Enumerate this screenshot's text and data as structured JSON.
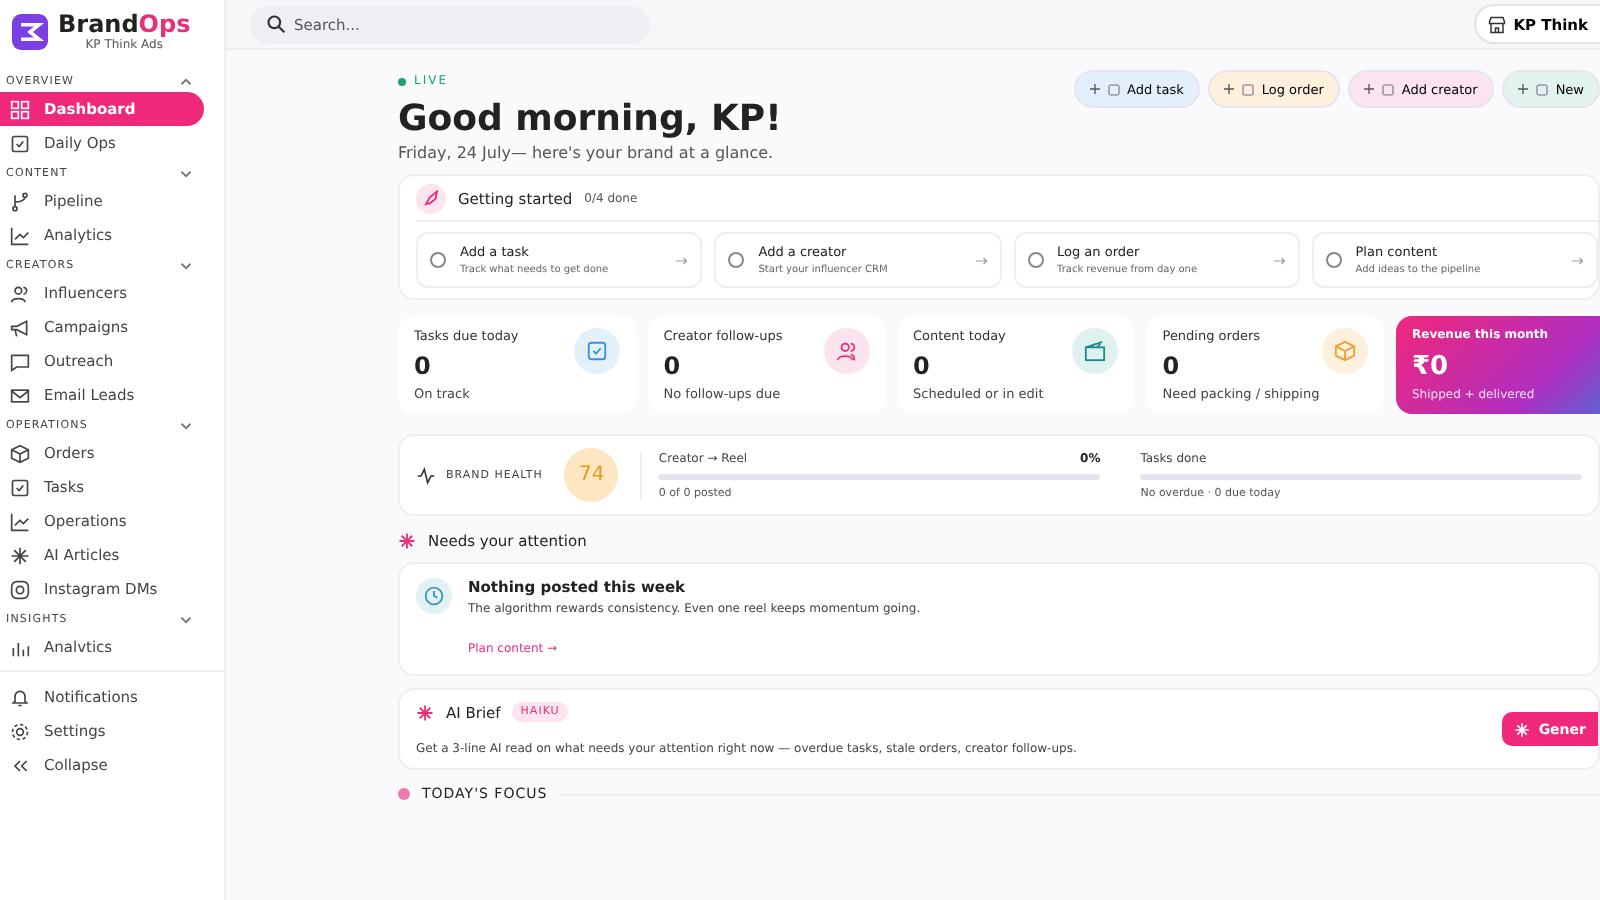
{
  "brand": {
    "name_a": "Brand",
    "name_b": "Ops",
    "workspace": "KP Think Ads"
  },
  "sidebar": {
    "sections": [
      {
        "title": "OVERVIEW",
        "expanded": true,
        "items": [
          {
            "label": "Dashboard",
            "selected": true
          },
          {
            "label": "Daily Ops",
            "selected": false
          }
        ]
      },
      {
        "title": "CONTENT",
        "expanded": false,
        "items": [
          {
            "label": "Pipeline",
            "selected": false
          },
          {
            "label": "Analytics",
            "selected": false
          }
        ]
      },
      {
        "title": "CREATORS",
        "expanded": false,
        "items": [
          {
            "label": "Influencers",
            "selected": false
          },
          {
            "label": "Campaigns",
            "selected": false
          },
          {
            "label": "Outreach",
            "selected": false
          },
          {
            "label": "Email Leads",
            "selected": false
          }
        ]
      },
      {
        "title": "OPERATIONS",
        "expanded": false,
        "items": [
          {
            "label": "Orders",
            "selected": false
          },
          {
            "label": "Tasks",
            "selected": false
          },
          {
            "label": "Operations",
            "selected": false
          },
          {
            "label": "AI Articles",
            "selected": false
          },
          {
            "label": "Instagram DMs",
            "selected": false
          }
        ]
      },
      {
        "title": "INSIGHTS",
        "expanded": false,
        "items": [
          {
            "label": "Analvtics",
            "selected": false
          }
        ]
      }
    ],
    "footer": [
      {
        "label": "Notifications"
      },
      {
        "label": "Settings"
      },
      {
        "label": "Collapse"
      }
    ]
  },
  "search": {
    "placeholder": "Search..."
  },
  "workspace_button": "KP Think",
  "live": "LIVE",
  "greeting": "Good morning, KP!",
  "subtitle": "Friday, 24 July— here's your brand at a glance.",
  "quick_actions": [
    {
      "label": "Add task",
      "color": "#e3f0fb"
    },
    {
      "label": "Log order",
      "color": "#fdf1dd"
    },
    {
      "label": "Add creator",
      "color": "#fbe3ef"
    },
    {
      "label": "New",
      "color": "#e2f3ef"
    }
  ],
  "getting_started": {
    "title": "Getting started",
    "count": "0/4 done",
    "steps": [
      {
        "title": "Add a task",
        "hint": "Track what needs to get done",
        "checked": false
      },
      {
        "title": "Add a creator",
        "hint": "Start your influencer CRM",
        "checked": false
      },
      {
        "title": "Log an order",
        "hint": "Track revenue from day one",
        "checked": false
      },
      {
        "title": "Plan content",
        "hint": "Add ideas to the pipeline",
        "checked": false
      }
    ]
  },
  "stats": [
    {
      "label": "Tasks due today",
      "value": "0",
      "note": "On track",
      "color": "#e3f1fb"
    },
    {
      "label": "Creator follow-ups",
      "value": "0",
      "note": "No follow-ups due",
      "color": "#fce4ef"
    },
    {
      "label": "Content today",
      "value": "0",
      "note": "Scheduled or in edit",
      "color": "#e0f2f0"
    },
    {
      "label": "Pending orders",
      "value": "0",
      "note": "Need packing / shipping",
      "color": "#fdf0dc"
    }
  ],
  "revenue": {
    "label": "Revenue this month",
    "value": "₹0",
    "note": "Shipped + delivered"
  },
  "brand_health": {
    "label": "BRAND HEALTH",
    "score": "74",
    "metrics": [
      {
        "label": "Creator → Reel",
        "value": "0%",
        "level": 0,
        "note": "0 of 0 posted"
      },
      {
        "label": "Tasks done",
        "level": 0,
        "note": "No overdue · 0 due today"
      }
    ]
  },
  "attention": {
    "title": "Needs your attention",
    "item": {
      "title": "Nothing posted this week",
      "text": "The algorithm rewards consistency. Even one reel keeps momentum going.",
      "link": "Plan content →"
    }
  },
  "ai_brief": {
    "title": "AI Brief",
    "badge": "HAIKU",
    "text": "Get a 3-line AI read on what needs your attention right now — overdue tasks, stale orders, creator follow-ups.",
    "button": "Gener"
  },
  "focus": {
    "title": "TODAY'S FOCUS"
  }
}
